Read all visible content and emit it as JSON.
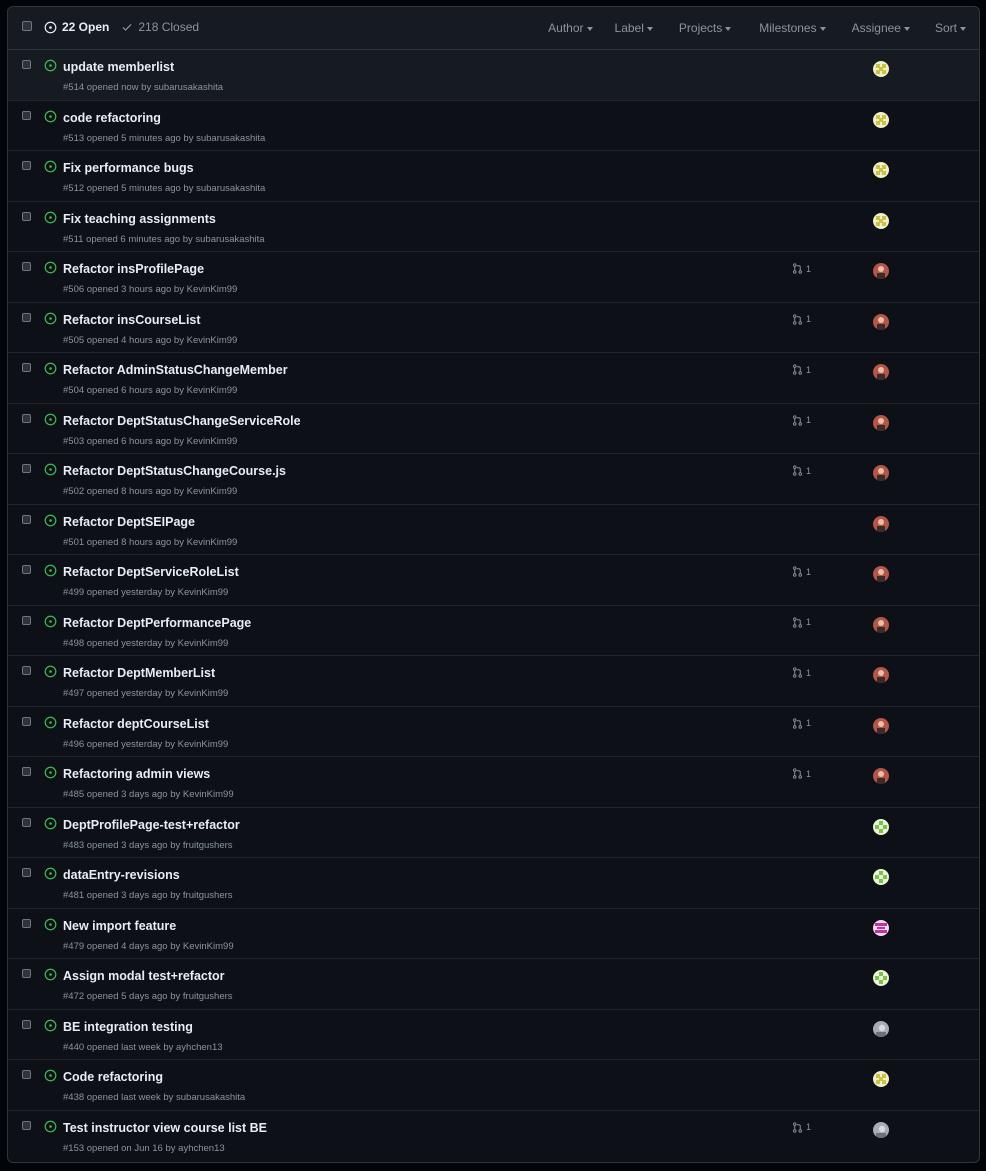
{
  "header": {
    "open_label": "22 Open",
    "closed_label": "218 Closed",
    "filters": [
      "Author",
      "Label",
      "Projects",
      "Milestones",
      "Assignee",
      "Sort"
    ]
  },
  "colors": {
    "open_icon": "#3fb950",
    "background": "#0d1117",
    "header_bg": "#161b22"
  },
  "issues": [
    {
      "title": "update memberlist",
      "meta": "#514 opened now by subarusakashita",
      "linked_prs": "",
      "avatar": "yellow-pattern-avatar",
      "highlighted": true
    },
    {
      "title": "code refactoring",
      "meta": "#513 opened 5 minutes ago by subarusakashita",
      "linked_prs": "",
      "avatar": "yellow-pattern-avatar"
    },
    {
      "title": "Fix performance bugs",
      "meta": "#512 opened 5 minutes ago by subarusakashita",
      "linked_prs": "",
      "avatar": "yellow-pattern-avatar"
    },
    {
      "title": "Fix teaching assignments",
      "meta": "#511 opened 6 minutes ago by subarusakashita",
      "linked_prs": "",
      "avatar": "yellow-pattern-avatar"
    },
    {
      "title": "Refactor insProfilePage",
      "meta": "#506 opened 3 hours ago by KevinKim99",
      "linked_prs": "1",
      "avatar": "photo-avatar-red"
    },
    {
      "title": "Refactor insCourseList",
      "meta": "#505 opened 4 hours ago by KevinKim99",
      "linked_prs": "1",
      "avatar": "photo-avatar-red"
    },
    {
      "title": "Refactor AdminStatusChangeMember",
      "meta": "#504 opened 6 hours ago by KevinKim99",
      "linked_prs": "1",
      "avatar": "photo-avatar-red"
    },
    {
      "title": "Refactor DeptStatusChangeServiceRole",
      "meta": "#503 opened 6 hours ago by KevinKim99",
      "linked_prs": "1",
      "avatar": "photo-avatar-red"
    },
    {
      "title": "Refactor DeptStatusChangeCourse.js",
      "meta": "#502 opened 8 hours ago by KevinKim99",
      "linked_prs": "1",
      "avatar": "photo-avatar-red"
    },
    {
      "title": "Refactor DeptSEIPage",
      "meta": "#501 opened 8 hours ago by KevinKim99",
      "linked_prs": "",
      "avatar": "photo-avatar-red"
    },
    {
      "title": "Refactor DeptServiceRoleList",
      "meta": "#499 opened yesterday by KevinKim99",
      "linked_prs": "1",
      "avatar": "photo-avatar-red"
    },
    {
      "title": "Refactor DeptPerformancePage",
      "meta": "#498 opened yesterday by KevinKim99",
      "linked_prs": "1",
      "avatar": "photo-avatar-red"
    },
    {
      "title": "Refactor DeptMemberList",
      "meta": "#497 opened yesterday by KevinKim99",
      "linked_prs": "1",
      "avatar": "photo-avatar-red"
    },
    {
      "title": "Refactor deptCourseList",
      "meta": "#496 opened yesterday by KevinKim99",
      "linked_prs": "1",
      "avatar": "photo-avatar-red"
    },
    {
      "title": "Refactoring admin views",
      "meta": "#485 opened 3 days ago by KevinKim99",
      "linked_prs": "1",
      "avatar": "photo-avatar-red"
    },
    {
      "title": "DeptProfilePage-test+refactor",
      "meta": "#483 opened 3 days ago by fruitgushers",
      "linked_prs": "",
      "avatar": "green-pattern-avatar"
    },
    {
      "title": "dataEntry-revisions",
      "meta": "#481 opened 3 days ago by fruitgushers",
      "linked_prs": "",
      "avatar": "green-pattern-avatar"
    },
    {
      "title": "New import feature",
      "meta": "#479 opened 4 days ago by KevinKim99",
      "linked_prs": "",
      "avatar": "pink-pattern-avatar"
    },
    {
      "title": "Assign modal test+refactor",
      "meta": "#472 opened 5 days ago by fruitgushers",
      "linked_prs": "",
      "avatar": "green-pattern-avatar"
    },
    {
      "title": "BE integration testing",
      "meta": "#440 opened last week by ayhchen13",
      "linked_prs": "",
      "avatar": "photo-avatar-gray"
    },
    {
      "title": "Code refactoring",
      "meta": "#438 opened last week by subarusakashita",
      "linked_prs": "",
      "avatar": "yellow-pattern-avatar"
    },
    {
      "title": "Test instructor view course list BE",
      "meta": "#153 opened on Jun 16 by ayhchen13",
      "linked_prs": "1",
      "avatar": "photo-avatar-gray"
    }
  ]
}
